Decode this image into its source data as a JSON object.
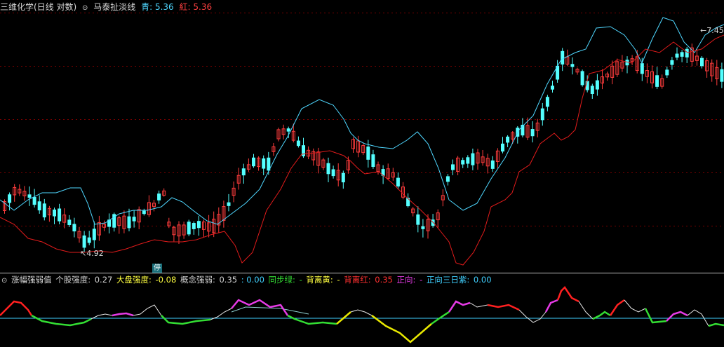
{
  "header": {
    "stock": "三维化学(日线 对数)",
    "indicator": "马泰扯淡线",
    "cyan_label": "青:",
    "cyan_value": "5.36",
    "red_label": "紅:",
    "red_value": "5.36",
    "high_label": "7.45",
    "low_label": "4.92",
    "halt_tag": "停"
  },
  "sub_header": {
    "name": "涨幅强弱值",
    "stock_strength_label": "个股强度:",
    "stock_strength_value": "0.27",
    "market_strength_label": "大盘强度:",
    "market_strength_value": "-0.08",
    "concept_label": "概念强弱:",
    "concept_value": "0.35",
    "sep1": ":",
    "sep1_value": "0.00",
    "sync_green_label": "同步绿:",
    "sync_green_value": "-",
    "diverge_yellow_label": "背离黄:",
    "diverge_yellow_value": "-",
    "diverge_red_label": "背离红:",
    "diverge_red_value": "0.35",
    "positive_label": "正向:",
    "positive_value": "-",
    "positive3_label": "正向三日紫:",
    "positive3_value": "0.00"
  },
  "colors": {
    "background": "#000000",
    "up_candle": "#ff3c3c",
    "down_candle": "#54ffff",
    "cyan_line": "#4fd7ff",
    "red_line": "#e11b1b",
    "grid": "#7a0000",
    "green": "#33dd33",
    "yellow": "#e8e800",
    "red": "#ff2020",
    "magenta": "#e63ae6",
    "white": "#e8e8e8",
    "baseline": "#40d0ff"
  }
}
